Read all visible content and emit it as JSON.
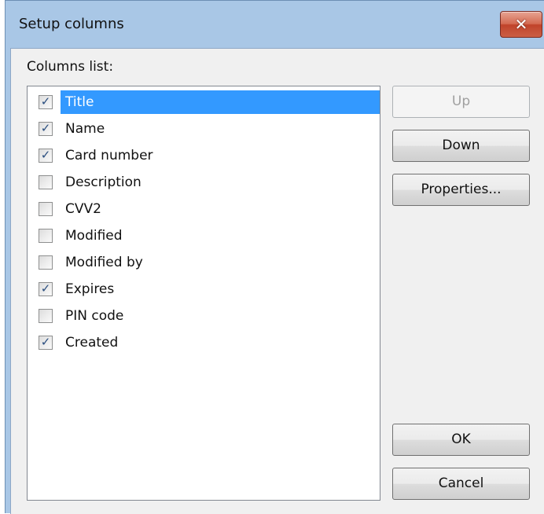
{
  "window": {
    "title": "Setup columns",
    "close_glyph": "✕"
  },
  "columns_label": "Columns list:",
  "columns": [
    {
      "label": "Title",
      "checked": true,
      "selected": true
    },
    {
      "label": "Name",
      "checked": true
    },
    {
      "label": "Card number",
      "checked": true
    },
    {
      "label": "Description",
      "checked": false
    },
    {
      "label": "CVV2",
      "checked": false
    },
    {
      "label": "Modified",
      "checked": false
    },
    {
      "label": "Modified by",
      "checked": false
    },
    {
      "label": "Expires",
      "checked": true
    },
    {
      "label": "PIN code",
      "checked": false
    },
    {
      "label": "Created",
      "checked": true
    }
  ],
  "check_glyph": "✓",
  "buttons": {
    "up": "Up",
    "down": "Down",
    "properties": "Properties...",
    "ok": "OK",
    "cancel": "Cancel"
  },
  "colors": {
    "selection": "#3399ff",
    "titlebar": "#a9c7e6",
    "close": "#c0432a"
  }
}
